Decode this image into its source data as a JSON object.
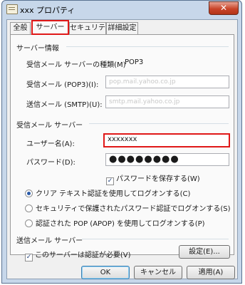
{
  "window": {
    "title": "xxx プロパティ",
    "close_glyph": "✕",
    "close_icon": "close-icon",
    "app_icon": "mail-account-icon"
  },
  "tabs": [
    {
      "label": "全般",
      "active": false
    },
    {
      "label": "サーバー",
      "active": true
    },
    {
      "label": "セキュリティ",
      "active": false
    },
    {
      "label": "詳細設定",
      "active": false
    }
  ],
  "server_info": {
    "heading": "サーバー情報",
    "incoming_type_label": "受信メール サーバーの種類(M)",
    "incoming_type_value": "POP3",
    "incoming_pop3_label": "受信メール (POP3)(I):",
    "incoming_pop3_value": "pop.mail.yahoo.co.jp",
    "outgoing_smtp_label": "送信メール (SMTP)(U):",
    "outgoing_smtp_value": "smtp.mail.yahoo.co.jp"
  },
  "incoming_server": {
    "heading": "受信メール サーバー",
    "username_label": "ユーザー名(A):",
    "username_value": "xxxxxxx",
    "password_label": "パスワード(D):",
    "password_value": "●●●●●●●●",
    "save_password_label": "パスワードを保存する(W)",
    "save_password_checked": true,
    "auth_options": [
      {
        "label": "クリア テキスト認証を使用してログオンする(C)",
        "selected": true
      },
      {
        "label": "セキュリティで保護されたパスワード認証でログオンする(S)",
        "selected": false
      },
      {
        "label": "認証された POP (APOP) を使用してログオンする(P)",
        "selected": false
      }
    ]
  },
  "outgoing_server": {
    "heading": "送信メール サーバー",
    "requires_auth_label": "このサーバーは認証が必要(V)",
    "requires_auth_checked": true,
    "settings_button": "設定(E)..."
  },
  "buttons": {
    "ok": "OK",
    "cancel": "キャンセル",
    "apply": "適用(A)"
  },
  "checkmark": "✓",
  "colors": {
    "highlight_red": "#e01818",
    "title_bar": "#c7d7ea",
    "close_button": "#c9452a"
  }
}
